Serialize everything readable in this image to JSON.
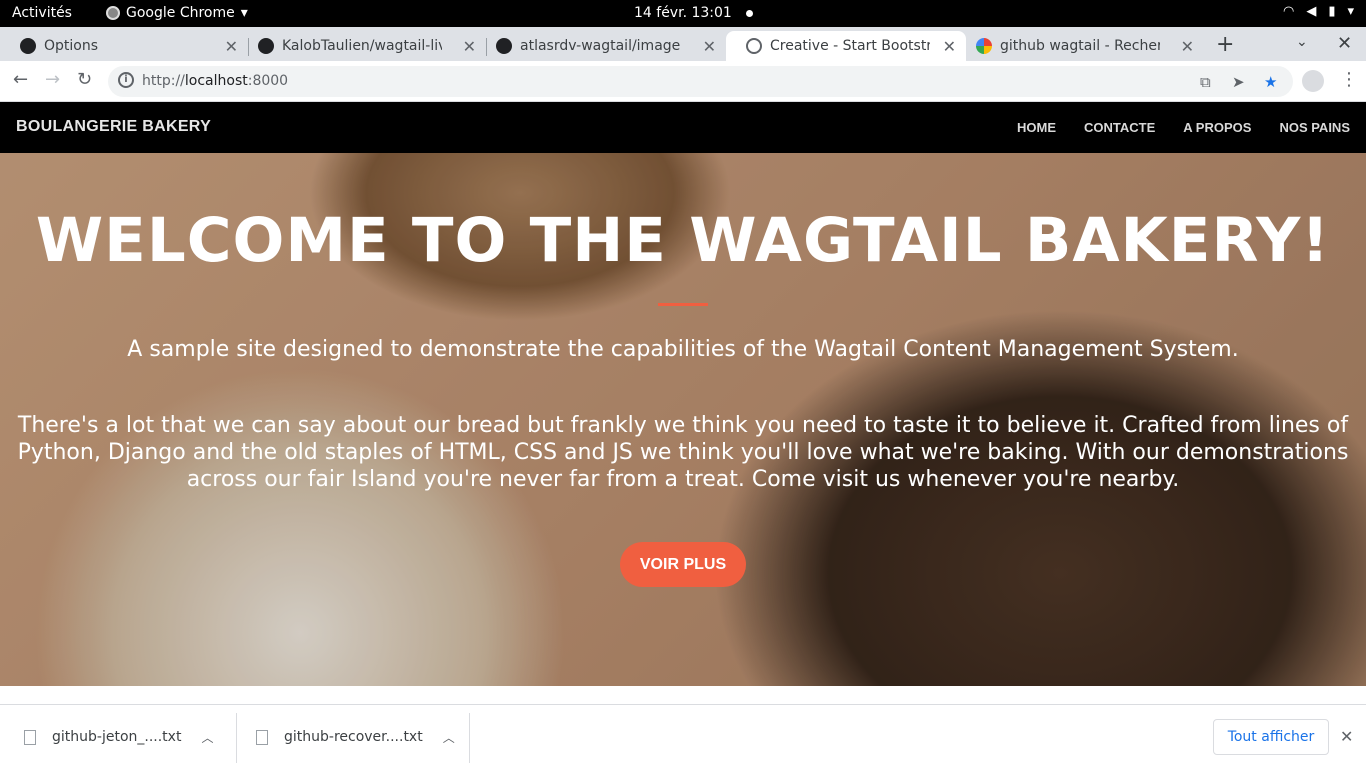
{
  "system": {
    "activities": "Activités",
    "app_name": "Google Chrome",
    "clock": "14 févr.  13:01"
  },
  "tabs": [
    {
      "title": "Options",
      "icon": "github-icon"
    },
    {
      "title": "KalobTaulien/wagtail-live",
      "icon": "github-icon"
    },
    {
      "title": "atlasrdv-wagtail/images a",
      "icon": "github-icon"
    },
    {
      "title": "Creative - Start Bootstrap",
      "icon": "globe-icon",
      "active": true
    },
    {
      "title": "github wagtail - Recherch",
      "icon": "google-icon"
    }
  ],
  "address_bar": {
    "url_prefix": "http://",
    "url_host": "localhost",
    "url_port": ":8000"
  },
  "site": {
    "brand": "BOULANGERIE BAKERY",
    "nav": [
      "HOME",
      "CONTACTE",
      "A PROPOS",
      "NOS PAINS"
    ],
    "hero": {
      "title": "WELCOME TO THE WAGTAIL BAKERY!",
      "subtitle": "A sample site designed to demonstrate the capabilities of the Wagtail Content Management System.",
      "body": "There's a lot that we can say about our bread but frankly we think you need to taste it to believe it. Crafted from lines of Python, Django and the old staples of HTML, CSS and JS we think you'll love what we're baking. With our demonstrations across our fair Island you're never far from a treat. Come visit us whenever you're nearby.",
      "cta": "VOIR PLUS"
    },
    "accent_color": "#f05f40"
  },
  "downloads": {
    "items": [
      "github-jeton_....txt",
      "github-recover....txt"
    ],
    "show_all": "Tout afficher"
  }
}
